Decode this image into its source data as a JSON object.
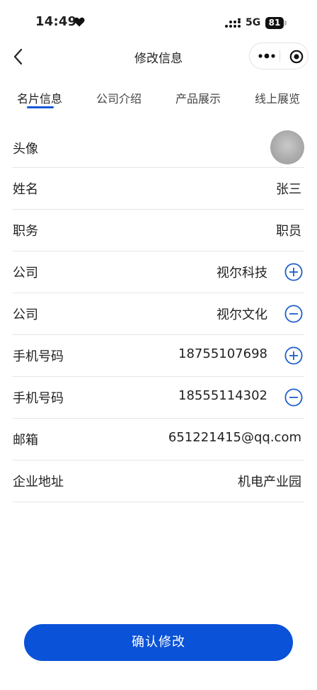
{
  "status_bar": {
    "time": "14:49",
    "network": "5G",
    "battery": "81"
  },
  "nav": {
    "title": "修改信息",
    "icons": [
      "back-arrow-icon",
      "more-icon",
      "target-icon"
    ]
  },
  "tabs": [
    {
      "label": "名片信息",
      "active": true
    },
    {
      "label": "公司介绍",
      "active": false
    },
    {
      "label": "产品展示",
      "active": false
    },
    {
      "label": "线上展览",
      "active": false
    }
  ],
  "form": {
    "avatar": {
      "label": "头像"
    },
    "name": {
      "label": "姓名",
      "value": "张三"
    },
    "position": {
      "label": "职务",
      "value": "职员"
    },
    "company1": {
      "label": "公司",
      "value": "视尔科技",
      "action": "plus-circle-icon"
    },
    "company2": {
      "label": "公司",
      "value": "视尔文化",
      "action": "minus-circle-icon"
    },
    "phone1": {
      "label": "手机号码",
      "value": "18755107698",
      "action": "plus-circle-icon"
    },
    "phone2": {
      "label": "手机号码",
      "value": "18555114302",
      "action": "minus-circle-icon"
    },
    "email": {
      "label": "邮箱",
      "value": "651221415@qq.com"
    },
    "address": {
      "label": "企业地址",
      "value": "机电产业园"
    }
  },
  "confirm_button": {
    "label": "确认修改"
  },
  "colors": {
    "accent": "#0A52D8",
    "divider": "#E6E6E6"
  }
}
